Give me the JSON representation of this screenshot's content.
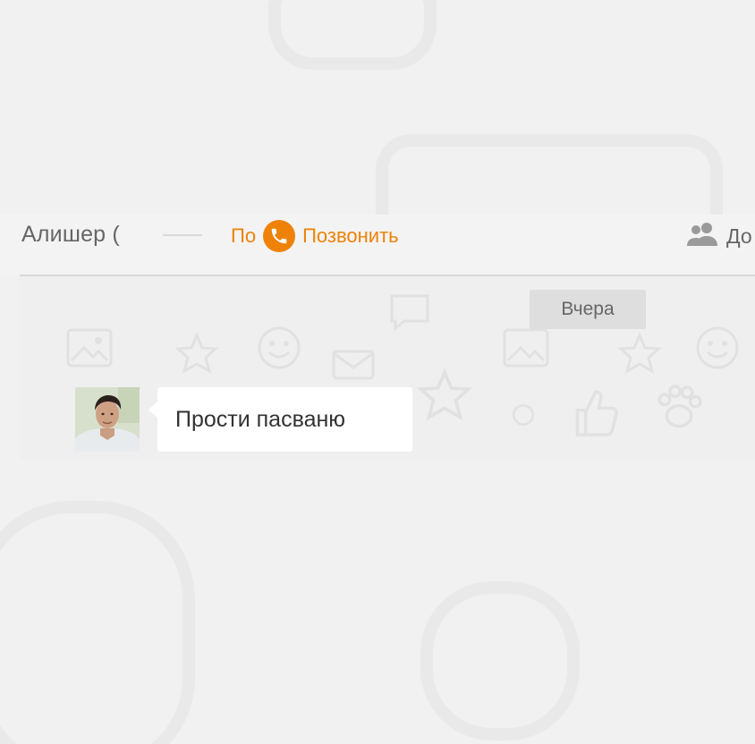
{
  "header": {
    "contact_name": "Алишер (",
    "call_prefix": "По",
    "call_label": "Позвонить",
    "friends_label": "До"
  },
  "conversation": {
    "date_separator": "Вчера",
    "messages": [
      {
        "text": "Прости пасваню"
      }
    ]
  },
  "colors": {
    "accent": "#ee8208",
    "text_gray": "#666666"
  },
  "icons": {
    "call": "phone-icon",
    "friends": "friends-icon"
  }
}
